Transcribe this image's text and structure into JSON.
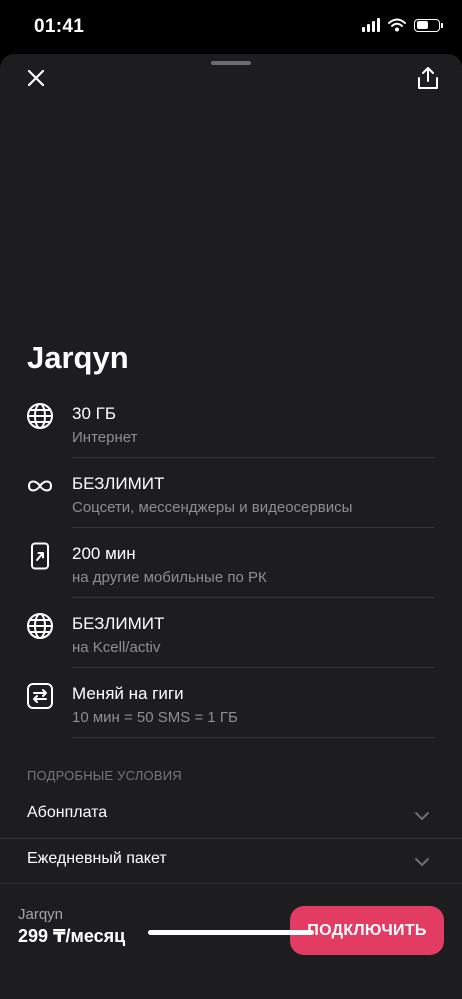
{
  "status_bar": {
    "time": "01:41",
    "battery_level": 0.55
  },
  "plan": {
    "title": "Jarqyn"
  },
  "features": [
    {
      "icon": "globe-icon",
      "title": "30 ГБ",
      "subtitle": "Интернет"
    },
    {
      "icon": "infinity-icon",
      "title": "БЕЗЛИМИТ",
      "subtitle": "Соцсети, мессенджеры и видеосервисы"
    },
    {
      "icon": "outgoing-call-icon",
      "title": "200 мин",
      "subtitle": "на другие мобильные по РК"
    },
    {
      "icon": "globe-icon",
      "title": "БЕЗЛИМИТ",
      "subtitle": "на Kcell/activ"
    },
    {
      "icon": "swap-icon",
      "title": "Меняй на гиги",
      "subtitle": "10 мин = 50 SMS = 1 ГБ"
    }
  ],
  "details": {
    "section_label": "ПОДРОБНЫЕ УСЛОВИЯ",
    "items": [
      {
        "label": "Абонплата"
      },
      {
        "label": "Ежедневный пакет"
      }
    ]
  },
  "bottom_bar": {
    "plan_name": "Jarqyn",
    "price": "299 ₸/месяц",
    "connect_label": "ПОДКЛЮЧИТЬ"
  },
  "colors": {
    "sheet_background": "#1d1d20",
    "accent": "#e23c63",
    "secondary_text": "#8e8e93"
  }
}
